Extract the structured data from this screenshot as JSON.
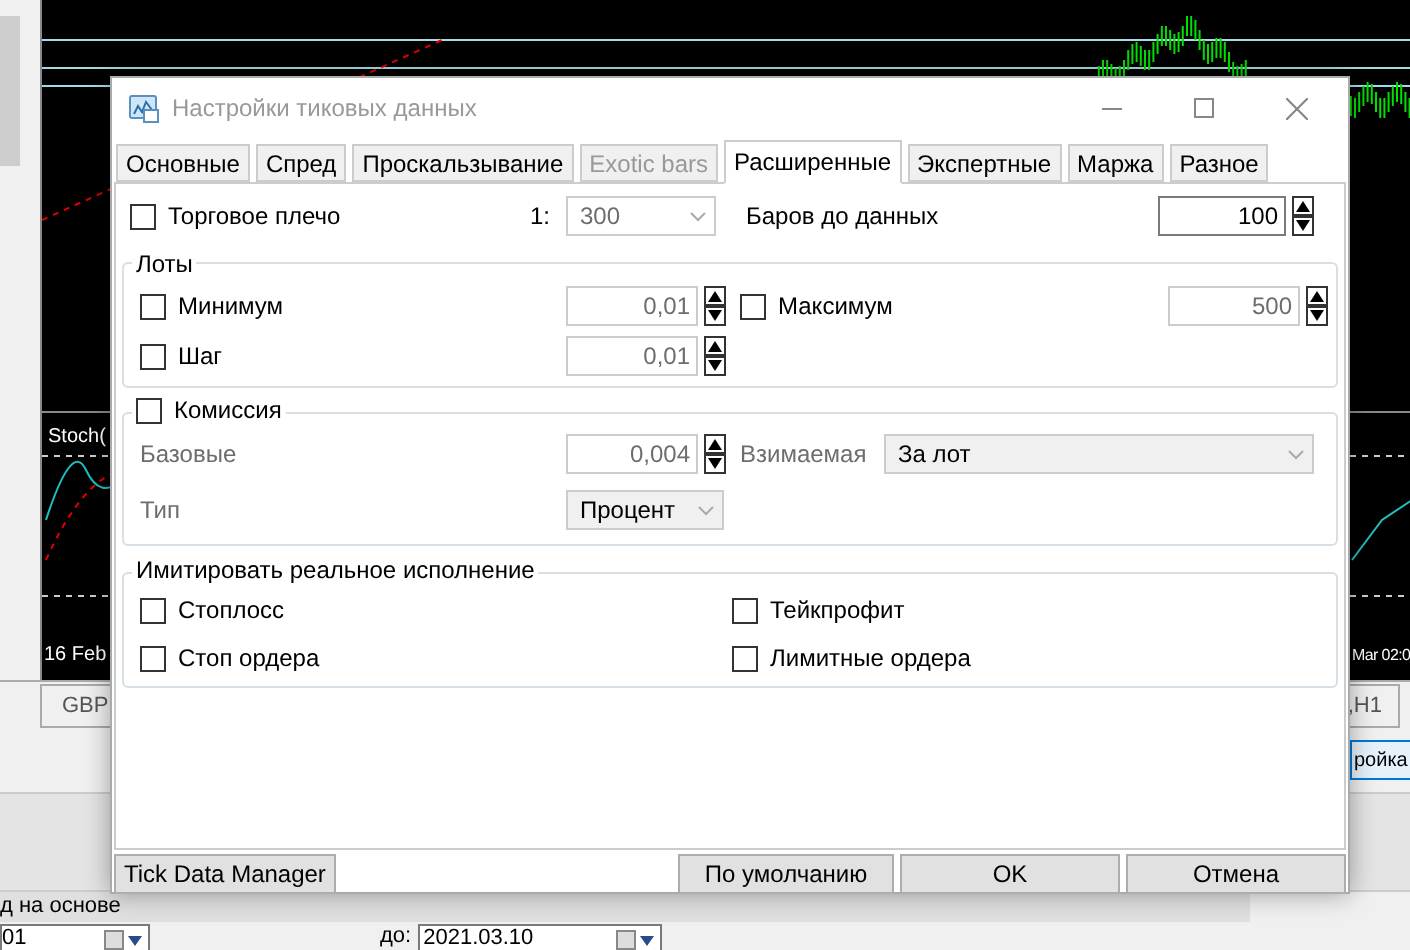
{
  "background": {
    "indicator_label": "Stoch(",
    "axis_labels": [
      "16 Feb",
      "Mar 02:0"
    ],
    "chart_tabs": [
      {
        "label": "GBP",
        "selected": false
      },
      {
        "label": ",H1",
        "selected": false
      }
    ],
    "side_button": "ройка",
    "description": "д на основе",
    "date_from": "01",
    "date_to_label": "до:",
    "date_to": "2021.03.10"
  },
  "dialog": {
    "title": "Настройки тиковых данных",
    "tabs": [
      {
        "label": "Основные",
        "selected": false,
        "disabled": false
      },
      {
        "label": "Спред",
        "selected": false,
        "disabled": false
      },
      {
        "label": "Проскальзывание",
        "selected": false,
        "disabled": false
      },
      {
        "label": "Exotic bars",
        "selected": false,
        "disabled": true
      },
      {
        "label": "Расширенные",
        "selected": true,
        "disabled": false
      },
      {
        "label": "Экспертные",
        "selected": false,
        "disabled": false
      },
      {
        "label": "Маржа",
        "selected": false,
        "disabled": false
      },
      {
        "label": "Разное",
        "selected": false,
        "disabled": false
      }
    ],
    "leverage": {
      "label": "Торговое плечо",
      "checked": false,
      "prefix": "1:",
      "value": "300",
      "disabled": true
    },
    "bars_before_data": {
      "label": "Баров до данных",
      "value": "100"
    },
    "lots": {
      "title": "Лоты",
      "minimum": {
        "label": "Минимум",
        "checked": false,
        "value": "0,01"
      },
      "maximum": {
        "label": "Максимум",
        "checked": false,
        "value": "500"
      },
      "step": {
        "label": "Шаг",
        "checked": false,
        "value": "0,01"
      }
    },
    "commission": {
      "label": "Комиссия",
      "checked": false,
      "base_label": "Базовые",
      "base_value": "0,004",
      "charged_label": "Взимаемая",
      "charged_value": "За лот",
      "type_label": "Тип",
      "type_value": "Процент",
      "disabled": true
    },
    "simulate": {
      "title": "Имитировать реальное исполнение",
      "items": [
        {
          "label": "Стоплосс",
          "checked": false
        },
        {
          "label": "Тейкпрофит",
          "checked": false
        },
        {
          "label": "Стоп ордера",
          "checked": false
        },
        {
          "label": "Лимитные ордера",
          "checked": false
        }
      ]
    },
    "buttons": {
      "tick_data_manager": "Tick Data Manager",
      "default": "По умолчанию",
      "ok": "OK",
      "cancel": "Отмена"
    }
  }
}
